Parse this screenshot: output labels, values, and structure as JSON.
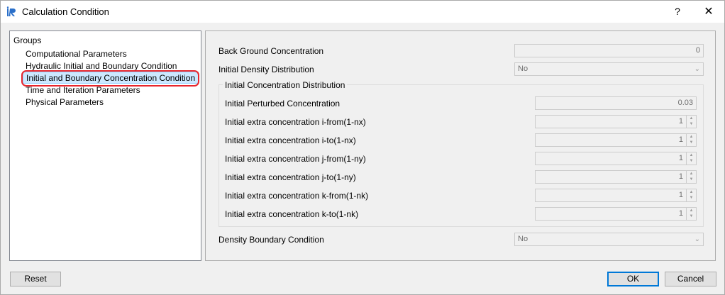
{
  "window": {
    "title": "Calculation Condition",
    "help": "?",
    "close": "✕"
  },
  "groups": {
    "header": "Groups",
    "items": [
      "Computational Parameters",
      "Hydraulic Initial and Boundary Condition",
      "Initial and Boundary Concentration Condition",
      "Time and Iteration Parameters",
      "Physical Parameters"
    ],
    "selected_index": 2
  },
  "form": {
    "back_ground_concentration": {
      "label": "Back Ground Concentration",
      "value": "0"
    },
    "initial_density_distribution": {
      "label": "Initial Density Distribution",
      "value": "No"
    },
    "initial_concentration_distribution": {
      "title": "Initial Concentration Distribution",
      "initial_perturbed": {
        "label": "Initial Perturbed Concentration",
        "value": "0.03"
      },
      "rows": [
        {
          "label": "Initial extra concentration i-from(1-nx)",
          "value": "1"
        },
        {
          "label": "Initial extra concentration i-to(1-nx)",
          "value": "1"
        },
        {
          "label": "Initial extra concentration j-from(1-ny)",
          "value": "1"
        },
        {
          "label": "Initial extra concentration j-to(1-ny)",
          "value": "1"
        },
        {
          "label": "Initial extra concentration k-from(1-nk)",
          "value": "1"
        },
        {
          "label": "Initial extra concentration k-to(1-nk)",
          "value": "1"
        }
      ]
    },
    "density_boundary_condition": {
      "label": "Density Boundary Condition",
      "value": "No"
    }
  },
  "buttons": {
    "reset": "Reset",
    "ok": "OK",
    "cancel": "Cancel"
  },
  "colors": {
    "selection": "#cce8ff",
    "highlight_ring": "#e8262d",
    "ok_border": "#0078d7"
  }
}
